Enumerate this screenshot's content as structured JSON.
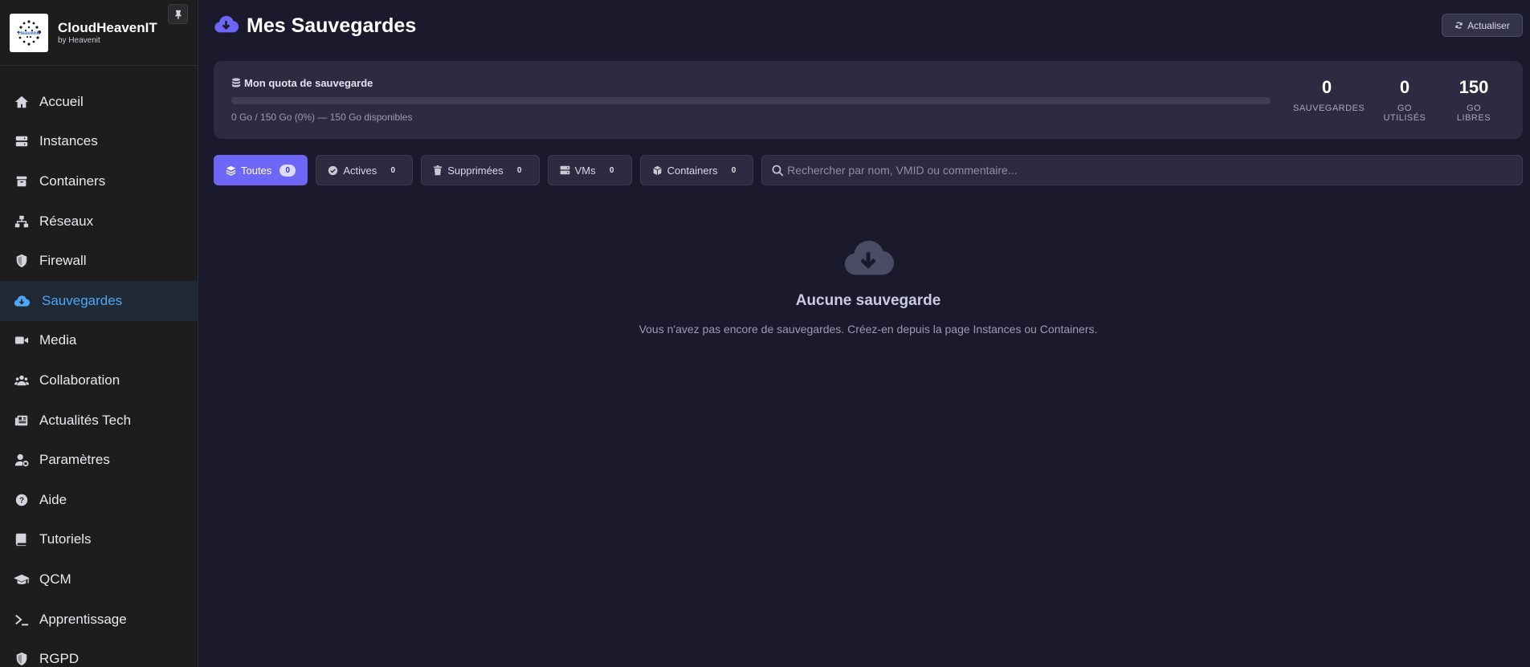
{
  "brand": {
    "name": "CloudHeavenIT",
    "subtitle": "by Heavenit",
    "logo_text": "Heavenit"
  },
  "sidebar": {
    "items": [
      {
        "label": "Accueil",
        "icon": "home-icon"
      },
      {
        "label": "Instances",
        "icon": "server-icon"
      },
      {
        "label": "Containers",
        "icon": "box-icon"
      },
      {
        "label": "Réseaux",
        "icon": "network-icon"
      },
      {
        "label": "Firewall",
        "icon": "shield-icon"
      },
      {
        "label": "Sauvegardes",
        "icon": "cloud-download-icon",
        "active": true
      },
      {
        "label": "Media",
        "icon": "video-icon"
      },
      {
        "label": "Collaboration",
        "icon": "users-icon"
      },
      {
        "label": "Actualités Tech",
        "icon": "newspaper-icon"
      },
      {
        "label": "Paramètres",
        "icon": "user-gear-icon"
      },
      {
        "label": "Aide",
        "icon": "help-icon"
      },
      {
        "label": "Tutoriels",
        "icon": "book-icon"
      },
      {
        "label": "QCM",
        "icon": "graduation-cap-icon"
      },
      {
        "label": "Apprentissage",
        "icon": "terminal-icon"
      },
      {
        "label": "RGPD",
        "icon": "shield-icon"
      }
    ]
  },
  "header": {
    "title": "Mes Sauvegardes",
    "refresh_label": "Actualiser"
  },
  "quota": {
    "title": "Mon quota de sauvegarde",
    "used_fraction": 0,
    "summary": "0 Go / 150 Go (0%) — 150 Go disponibles",
    "stats": [
      {
        "value": "0",
        "label": "SAUVEGARDES"
      },
      {
        "value": "0",
        "label": "GO UTILISÉS"
      },
      {
        "value": "150",
        "label": "GO LIBRES"
      }
    ]
  },
  "filters": [
    {
      "label": "Toutes",
      "count": "0",
      "active": true,
      "icon": "layers-icon"
    },
    {
      "label": "Actives",
      "count": "0",
      "icon": "check-circle-icon"
    },
    {
      "label": "Supprimées",
      "count": "0",
      "icon": "trash-icon"
    },
    {
      "label": "VMs",
      "count": "0",
      "icon": "server-icon"
    },
    {
      "label": "Containers",
      "count": "0",
      "icon": "cube-icon"
    }
  ],
  "search": {
    "placeholder": "Rechercher par nom, VMID ou commentaire..."
  },
  "empty_state": {
    "title": "Aucune sauvegarde",
    "message": "Vous n'avez pas encore de sauvegardes. Créez-en depuis la page Instances ou Containers."
  },
  "colors": {
    "accent": "#6d66f6",
    "active_nav": "#4ea6f4",
    "background": "#1b1a2c",
    "card": "#2c2b41"
  }
}
